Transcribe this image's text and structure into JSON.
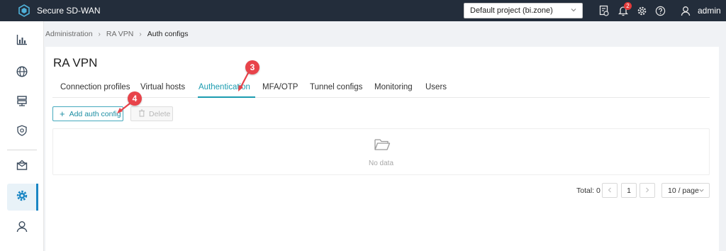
{
  "app": {
    "title": "Secure SD-WAN"
  },
  "header": {
    "project": "Default project (bi.zone)",
    "notification_count": "2",
    "user": "admin"
  },
  "breadcrumb": [
    "Administration",
    "RA VPN",
    "Auth configs"
  ],
  "page": {
    "title": "RA VPN"
  },
  "tabs": [
    {
      "label": "Connection profiles"
    },
    {
      "label": "Virtual hosts"
    },
    {
      "label": "Authentication",
      "active": true
    },
    {
      "label": "MFA/OTP"
    },
    {
      "label": "Tunnel configs"
    },
    {
      "label": "Monitoring"
    },
    {
      "label": "Users"
    }
  ],
  "toolbar": {
    "add_label": "Add auth config",
    "delete_label": "Delete"
  },
  "table": {
    "empty_text": "No data"
  },
  "pagination": {
    "total": "Total: 0",
    "current_page": "1",
    "page_size": "10 / page"
  },
  "callouts": [
    "3",
    "4"
  ],
  "colors": {
    "topbar": "#232d3b",
    "accent": "#1c9cb0",
    "callout": "#e8434a",
    "sidebar_active": "#1a86c4"
  }
}
